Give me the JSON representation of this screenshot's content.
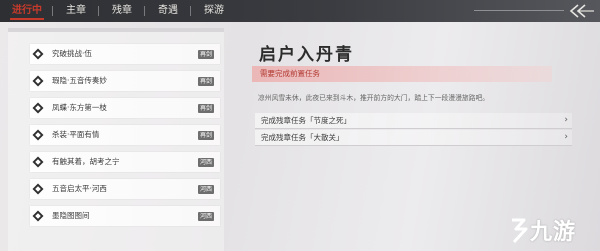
{
  "tabs": [
    {
      "label": "进行中",
      "active": true
    },
    {
      "label": "主章",
      "active": false
    },
    {
      "label": "残章",
      "active": false
    },
    {
      "label": "奇遇",
      "active": false
    },
    {
      "label": "探游",
      "active": false
    }
  ],
  "back_icon": "back-arrow-icon",
  "quests": [
    {
      "name": "究破挑战·伍",
      "badge": "再剑",
      "icon": "diamond-icon"
    },
    {
      "name": "瑕隐·五音传奏妙",
      "badge": "再剑",
      "icon": "diamond-icon"
    },
    {
      "name": "凤蝶·东方第一枝",
      "badge": "再剑",
      "icon": "diamond-icon"
    },
    {
      "name": "杀装·平面有情",
      "badge": "再剑",
      "icon": "diamond-icon"
    },
    {
      "name": "有触其着，胡考之宁",
      "badge": "河西",
      "icon": "diamond-icon"
    },
    {
      "name": "五音启太平·河西",
      "badge": "河西",
      "icon": "diamond-icon"
    },
    {
      "name": "墨隐图图间",
      "badge": "河西",
      "icon": "diamond-icon"
    }
  ],
  "detail": {
    "title": "启户入丹青",
    "warning": "需要完成前置任务",
    "description": "凉州风雪未休，此夜已来到斗木，推开前方的大门，踏上下一段漫漫旅路吧。",
    "subtasks": [
      {
        "label": "完成残章任务「节度之死」"
      },
      {
        "label": "完成残章任务「大散关」"
      }
    ]
  },
  "colors": {
    "accent": "#c63a2b",
    "topbar": "#2d2f33",
    "warning_bg": "#ecb2b2"
  },
  "watermark": {
    "text": "九游",
    "icon": "jiuyou-logo"
  }
}
